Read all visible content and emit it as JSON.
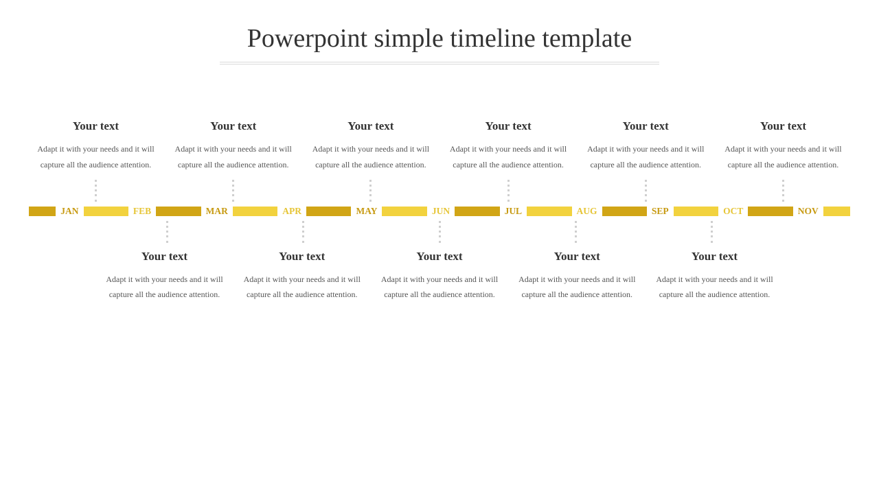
{
  "title": "Powerpoint simple timeline template",
  "placeholder_heading": "Your text",
  "placeholder_body": "Adapt it with your needs and it will capture all the audience attention.",
  "top_cards": [
    {
      "heading": "Your text",
      "body": "Adapt it with your needs and it will capture all the audience attention."
    },
    {
      "heading": "Your text",
      "body": "Adapt it with your needs and it will capture all the audience attention."
    },
    {
      "heading": "Your text",
      "body": "Adapt it with your needs and it will capture all the audience attention."
    },
    {
      "heading": "Your text",
      "body": "Adapt it with your needs and it will capture all the audience attention."
    },
    {
      "heading": "Your text",
      "body": "Adapt it with your needs and it will capture all the audience attention."
    },
    {
      "heading": "Your text",
      "body": "Adapt it with your needs and it will capture all the audience attention."
    }
  ],
  "bottom_cards": [
    {
      "heading": "Your text",
      "body": "Adapt it with your needs and it will capture all the audience attention."
    },
    {
      "heading": "Your text",
      "body": "Adapt it with your needs and it will capture all the audience attention."
    },
    {
      "heading": "Your text",
      "body": "Adapt it with your needs and it will capture all the audience attention."
    },
    {
      "heading": "Your text",
      "body": "Adapt it with your needs and it will capture all the audience attention."
    },
    {
      "heading": "Your text",
      "body": "Adapt it with your needs and it will capture all the audience attention."
    }
  ],
  "months": [
    "JAN",
    "FEB",
    "MAR",
    "APR",
    "MAY",
    "JUN",
    "JUL",
    "AUG",
    "SEP",
    "OCT",
    "NOV"
  ],
  "colors": {
    "segment_dark": "#d1a516",
    "segment_light": "#f2d23e",
    "month_dark": "#c79a12",
    "month_light": "#e6c537"
  }
}
